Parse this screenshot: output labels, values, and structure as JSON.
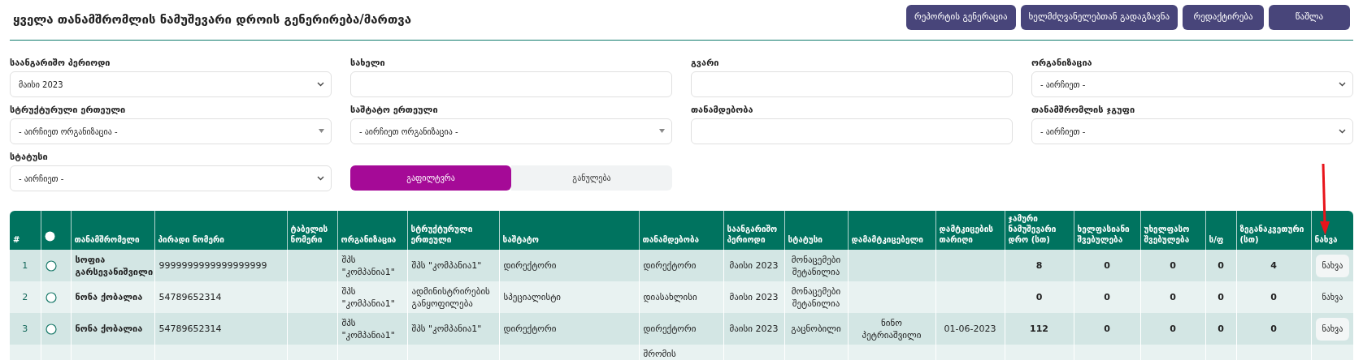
{
  "title": "ყველა თანამშრომლის ნამუშევარი დროის გენერირება/მართვა",
  "actions": [
    "რეპორტის გენერაცია",
    "ხელმძღვანელებთან გადაგზავნა",
    "რედაქტირება",
    "წაშლა"
  ],
  "filters": [
    {
      "kind": "select",
      "label": "საანგარიშო პერიოდი",
      "value": "მაისი 2023"
    },
    {
      "kind": "text",
      "label": "სახელი"
    },
    {
      "kind": "text",
      "label": "გვარი"
    },
    {
      "kind": "select",
      "label": "ორგანიზაცია",
      "value": "- აირჩიეთ -"
    },
    {
      "kind": "searchable_select",
      "label": "სტრუქტურული ერთეული",
      "value": "- აირჩიეთ ორგანიზაცია -"
    },
    {
      "kind": "searchable_select",
      "label": "საშტატო ერთეული",
      "value": "- აირჩიეთ ორგანიზაცია -"
    },
    {
      "kind": "text",
      "label": "თანამდებობა"
    },
    {
      "kind": "select",
      "label": "თანამშრომლის ჯგუფი",
      "value": "- აირჩიეთ -"
    },
    {
      "kind": "select",
      "label": "სტატუსი",
      "value": "- აირჩიეთ -"
    }
  ],
  "filter_buttons": [
    {
      "kind": "primary",
      "label": "გაფილტვრა"
    },
    {
      "kind": "secondary",
      "label": "განულება"
    }
  ],
  "table": {
    "columns": [
      {
        "kind": "text",
        "label": "#"
      },
      {
        "kind": "radio"
      },
      {
        "kind": "text",
        "label": "თანამშრომელი"
      },
      {
        "kind": "text",
        "label": "პირადი ნომერი"
      },
      {
        "kind": "text",
        "label": "ტაბელის ნომერი"
      },
      {
        "kind": "text",
        "label": "ორგანიზაცია"
      },
      {
        "kind": "text",
        "label": "სტრუქტურული ერთეული"
      },
      {
        "kind": "text",
        "label": "საშტატო"
      },
      {
        "kind": "text",
        "label": "თანამდებობა"
      },
      {
        "kind": "text",
        "label": "საანგარიშო პერიოდი"
      },
      {
        "kind": "text",
        "label": "სტატუსი"
      },
      {
        "kind": "text",
        "label": "დამამტკიცებელი"
      },
      {
        "kind": "text",
        "label": "დამტკიცების თარიღი"
      },
      {
        "kind": "text",
        "label": "ჯამური ნამუშევარი დრო (სთ)"
      },
      {
        "kind": "text",
        "label": "ხელფასიანი შვებულება"
      },
      {
        "kind": "text",
        "label": "უხელფასო შვებულება"
      },
      {
        "kind": "text",
        "label": "ს/ფ"
      },
      {
        "kind": "text",
        "label": "ზეგანაკვეთური (სთ)"
      },
      {
        "kind": "text",
        "label": "ნახვა"
      }
    ],
    "rows": [
      {
        "selected": false,
        "cells": [
          "1",
          "",
          "სოფია გარსევანიშვილი",
          "9999999999999999999",
          "",
          "შპს \"კომპანია1\"",
          "შპს \"კომპანია1\"",
          "დირექტორი",
          "დირექტორი",
          "მაისი 2023",
          "მონაცემები შეტანილია",
          "",
          "",
          "8",
          "0",
          "0",
          "0",
          "4",
          "ნახვა"
        ]
      },
      {
        "selected": false,
        "cells": [
          "2",
          "",
          "ნონა ქობალია",
          "54789652314",
          "",
          "შპს \"კომპანია1\"",
          "ადმინისტრირების განყოფილება",
          "სპეციალისტი",
          "დიასახლისი",
          "მაისი 2023",
          "მონაცემები შეტანილია",
          "",
          "",
          "0",
          "0",
          "0",
          "0",
          "0",
          "ნახვა"
        ]
      },
      {
        "selected": false,
        "cells": [
          "3",
          "",
          "ნონა ქობალია",
          "54789652314",
          "",
          "შპს \"კომპანია1\"",
          "შპს \"კომპანია1\"",
          "დირექტორი",
          "დირექტორი",
          "მაისი 2023",
          "გაცნობილი",
          "ნინო პეტრიაშვილი",
          "01-06-2023",
          "112",
          "0",
          "0",
          "0",
          "0",
          "ნახვა"
        ]
      },
      {
        "cells": [
          "",
          "",
          "",
          "",
          "",
          "",
          "",
          "",
          "შრომის",
          "",
          "",
          "",
          "",
          "",
          "",
          "",
          "",
          "",
          ""
        ]
      }
    ]
  }
}
